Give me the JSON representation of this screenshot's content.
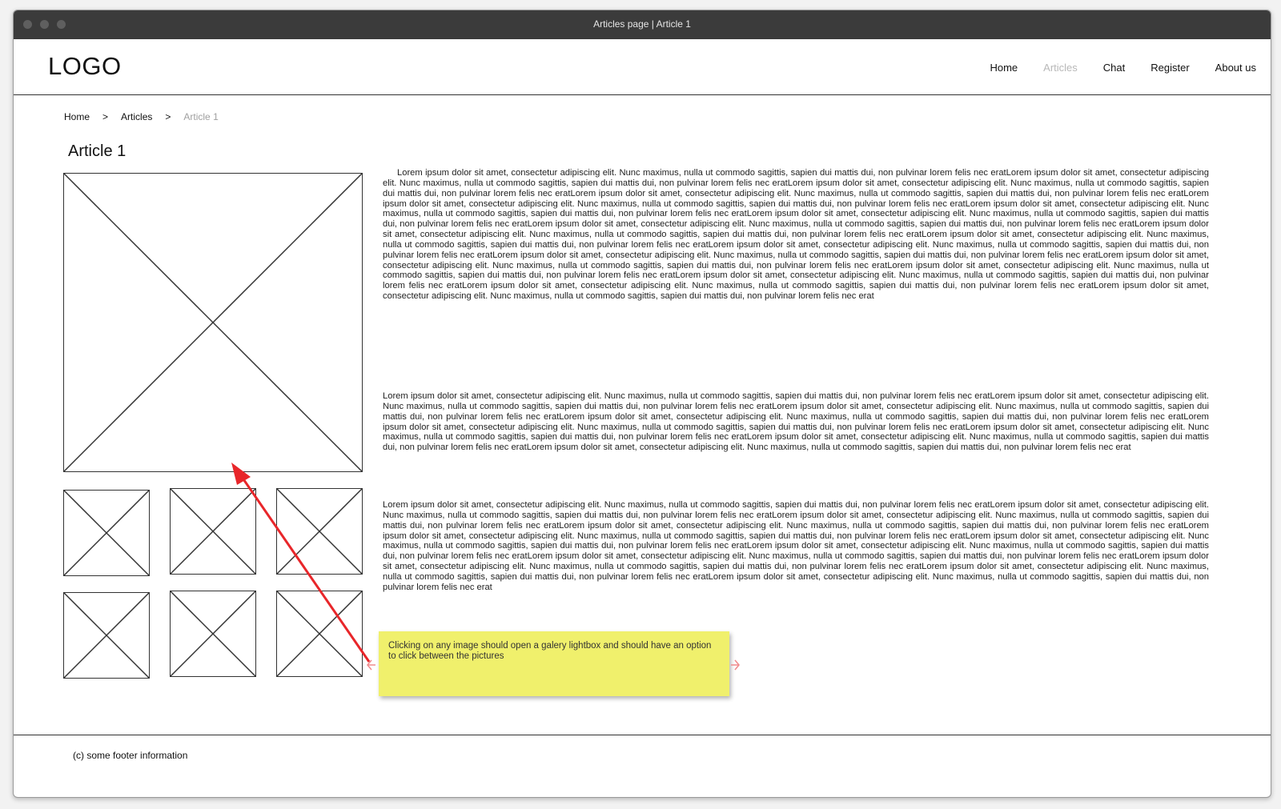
{
  "window": {
    "title": "Articles page | Article 1"
  },
  "header": {
    "logo": "LOGO",
    "nav": [
      {
        "label": "Home",
        "active": false
      },
      {
        "label": "Articles",
        "active": true
      },
      {
        "label": "Chat",
        "active": false
      },
      {
        "label": "Register",
        "active": false
      },
      {
        "label": "About us",
        "active": false
      }
    ]
  },
  "breadcrumb": {
    "items": [
      "Home",
      "Articles",
      "Article 1"
    ],
    "separator": ">"
  },
  "article": {
    "title": "Article 1",
    "paragraphs": [
      "Lorem ipsum dolor sit amet, consectetur adipiscing elit. Nunc maximus, nulla ut commodo sagittis, sapien dui mattis dui, non pulvinar lorem felis nec eratLorem ipsum dolor sit amet, consectetur adipiscing elit. Nunc maximus, nulla ut commodo sagittis, sapien dui mattis dui, non pulvinar lorem felis nec eratLorem ipsum dolor sit amet, consectetur adipiscing elit. Nunc maximus, nulla ut commodo sagittis, sapien dui mattis dui, non pulvinar lorem felis nec eratLorem ipsum dolor sit amet, consectetur adipiscing elit. Nunc maximus, nulla ut commodo sagittis, sapien dui mattis dui, non pulvinar lorem felis nec eratLorem ipsum dolor sit amet, consectetur adipiscing elit. Nunc maximus, nulla ut commodo sagittis, sapien dui mattis dui, non pulvinar lorem felis nec eratLorem ipsum dolor sit amet, consectetur adipiscing elit. Nunc maximus, nulla ut commodo sagittis, sapien dui mattis dui, non pulvinar lorem felis nec eratLorem ipsum dolor sit amet, consectetur adipiscing elit. Nunc maximus, nulla ut commodo sagittis, sapien dui mattis dui, non pulvinar lorem felis nec eratLorem ipsum dolor sit amet, consectetur adipiscing elit. Nunc maximus, nulla ut commodo sagittis, sapien dui mattis dui, non pulvinar lorem felis nec eratLorem ipsum dolor sit amet, consectetur adipiscing elit. Nunc maximus, nulla ut commodo sagittis, sapien dui mattis dui, non pulvinar lorem felis nec eratLorem ipsum dolor sit amet, consectetur adipiscing elit. Nunc maximus, nulla ut commodo sagittis, sapien dui mattis dui, non pulvinar lorem felis nec eratLorem ipsum dolor sit amet, consectetur adipiscing elit. Nunc maximus, nulla ut commodo sagittis, sapien dui mattis dui, non pulvinar lorem felis nec eratLorem ipsum dolor sit amet, consectetur adipiscing elit. Nunc maximus, nulla ut commodo sagittis, sapien dui mattis dui, non pulvinar lorem felis nec eratLorem ipsum dolor sit amet, consectetur adipiscing elit. Nunc maximus, nulla ut commodo sagittis, sapien dui mattis dui, non pulvinar lorem felis nec eratLorem ipsum dolor sit amet, consectetur adipiscing elit. Nunc maximus, nulla ut commodo sagittis, sapien dui mattis dui, non pulvinar lorem felis nec eratLorem ipsum dolor sit amet, consectetur adipiscing elit. Nunc maximus, nulla ut commodo sagittis, sapien dui mattis dui, non pulvinar lorem felis nec eratLorem ipsum dolor sit amet, consectetur adipiscing elit. Nunc maximus, nulla ut commodo sagittis, sapien dui mattis dui, non pulvinar lorem felis nec eratLorem ipsum dolor sit amet, consectetur adipiscing elit. Nunc maximus, nulla ut commodo sagittis, sapien dui mattis dui, non pulvinar lorem felis nec erat",
      "Lorem ipsum dolor sit amet, consectetur adipiscing elit. Nunc maximus, nulla ut commodo sagittis, sapien dui mattis dui, non pulvinar lorem felis nec eratLorem ipsum dolor sit amet, consectetur adipiscing elit. Nunc maximus, nulla ut commodo sagittis, sapien dui mattis dui, non pulvinar lorem felis nec eratLorem ipsum dolor sit amet, consectetur adipiscing elit. Nunc maximus, nulla ut commodo sagittis, sapien dui mattis dui, non pulvinar lorem felis nec eratLorem ipsum dolor sit amet, consectetur adipiscing elit. Nunc maximus, nulla ut commodo sagittis, sapien dui mattis dui, non pulvinar lorem felis nec eratLorem ipsum dolor sit amet, consectetur adipiscing elit. Nunc maximus, nulla ut commodo sagittis, sapien dui mattis dui, non pulvinar lorem felis nec eratLorem ipsum dolor sit amet, consectetur adipiscing elit. Nunc maximus, nulla ut commodo sagittis, sapien dui mattis dui, non pulvinar lorem felis nec eratLorem ipsum dolor sit amet, consectetur adipiscing elit. Nunc maximus, nulla ut commodo sagittis, sapien dui mattis dui, non pulvinar lorem felis nec eratLorem ipsum dolor sit amet, consectetur adipiscing elit. Nunc maximus, nulla ut commodo sagittis, sapien dui mattis dui, non pulvinar lorem felis nec erat",
      "Lorem ipsum dolor sit amet, consectetur adipiscing elit. Nunc maximus, nulla ut commodo sagittis, sapien dui mattis dui, non pulvinar lorem felis nec eratLorem ipsum dolor sit amet, consectetur adipiscing elit. Nunc maximus, nulla ut commodo sagittis, sapien dui mattis dui, non pulvinar lorem felis nec eratLorem ipsum dolor sit amet, consectetur adipiscing elit. Nunc maximus, nulla ut commodo sagittis, sapien dui mattis dui, non pulvinar lorem felis nec eratLorem ipsum dolor sit amet, consectetur adipiscing elit. Nunc maximus, nulla ut commodo sagittis, sapien dui mattis dui, non pulvinar lorem felis nec eratLorem ipsum dolor sit amet, consectetur adipiscing elit. Nunc maximus, nulla ut commodo sagittis, sapien dui mattis dui, non pulvinar lorem felis nec eratLorem ipsum dolor sit amet, consectetur adipiscing elit. Nunc maximus, nulla ut commodo sagittis, sapien dui mattis dui, non pulvinar lorem felis nec eratLorem ipsum dolor sit amet, consectetur adipiscing elit. Nunc maximus, nulla ut commodo sagittis, sapien dui mattis dui, non pulvinar lorem felis nec eratLorem ipsum dolor sit amet, consectetur adipiscing elit. Nunc maximus, nulla ut commodo sagittis, sapien dui mattis dui, non pulvinar lorem felis nec eratLorem ipsum dolor sit amet, consectetur adipiscing elit. Nunc maximus, nulla ut commodo sagittis, sapien dui mattis dui, non pulvinar lorem felis nec eratLorem ipsum dolor sit amet, consectetur adipiscing elit. Nunc maximus, nulla ut commodo sagittis, sapien dui mattis dui, non pulvinar lorem felis nec eratLorem ipsum dolor sit amet, consectetur adipiscing elit. Nunc maximus, nulla ut commodo sagittis, sapien dui mattis dui, non pulvinar lorem felis nec erat"
    ]
  },
  "annotation": {
    "note": "Clicking on any image should open a galery lightbox and should have an option to click between the pictures",
    "arrow_color": "#e8262a",
    "note_color": "#f0f06c"
  },
  "footer": {
    "text": "(c) some footer information"
  }
}
